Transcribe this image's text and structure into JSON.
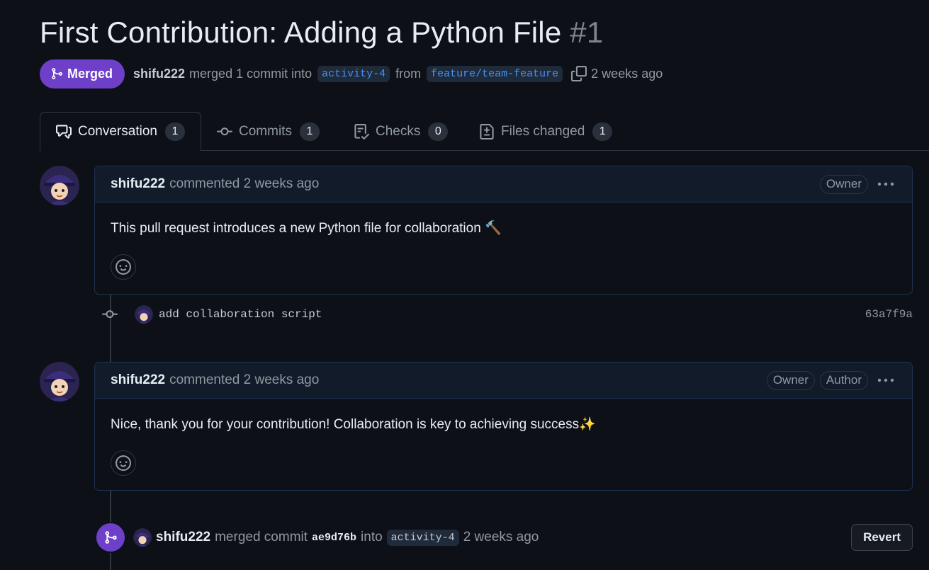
{
  "pr": {
    "title": "First Contribution: Adding a Python File",
    "number": "#1",
    "state": "Merged",
    "author": "shifu222",
    "merge_text": "merged 1 commit into",
    "base_branch": "activity-4",
    "from_text": "from",
    "head_branch": "feature/team-feature",
    "time": "2 weeks ago"
  },
  "tabs": [
    {
      "label": "Conversation",
      "count": "1",
      "icon": "comment-discussion-icon"
    },
    {
      "label": "Commits",
      "count": "1",
      "icon": "git-commit-icon"
    },
    {
      "label": "Checks",
      "count": "0",
      "icon": "checklist-icon"
    },
    {
      "label": "Files changed",
      "count": "1",
      "icon": "file-diff-icon"
    }
  ],
  "comments": [
    {
      "author": "shifu222",
      "action": "commented 2 weeks ago",
      "roles": [
        "Owner"
      ],
      "body": "This pull request introduces a new Python file for collaboration 🔨"
    },
    {
      "author": "shifu222",
      "action": "commented 2 weeks ago",
      "roles": [
        "Owner",
        "Author"
      ],
      "body": "Nice, thank you for your contribution! Collaboration is key to achieving success✨"
    }
  ],
  "commit": {
    "message": "add collaboration script",
    "sha": "63a7f9a"
  },
  "merge_event": {
    "author": "shifu222",
    "text1": "merged commit",
    "sha": "ae9d76b",
    "text2": "into",
    "branch": "activity-4",
    "time": "2 weeks ago",
    "revert_label": "Revert"
  },
  "colors": {
    "background": "#0d1117",
    "merged_purple": "#6e40c9",
    "link_blue": "#4493f8"
  }
}
